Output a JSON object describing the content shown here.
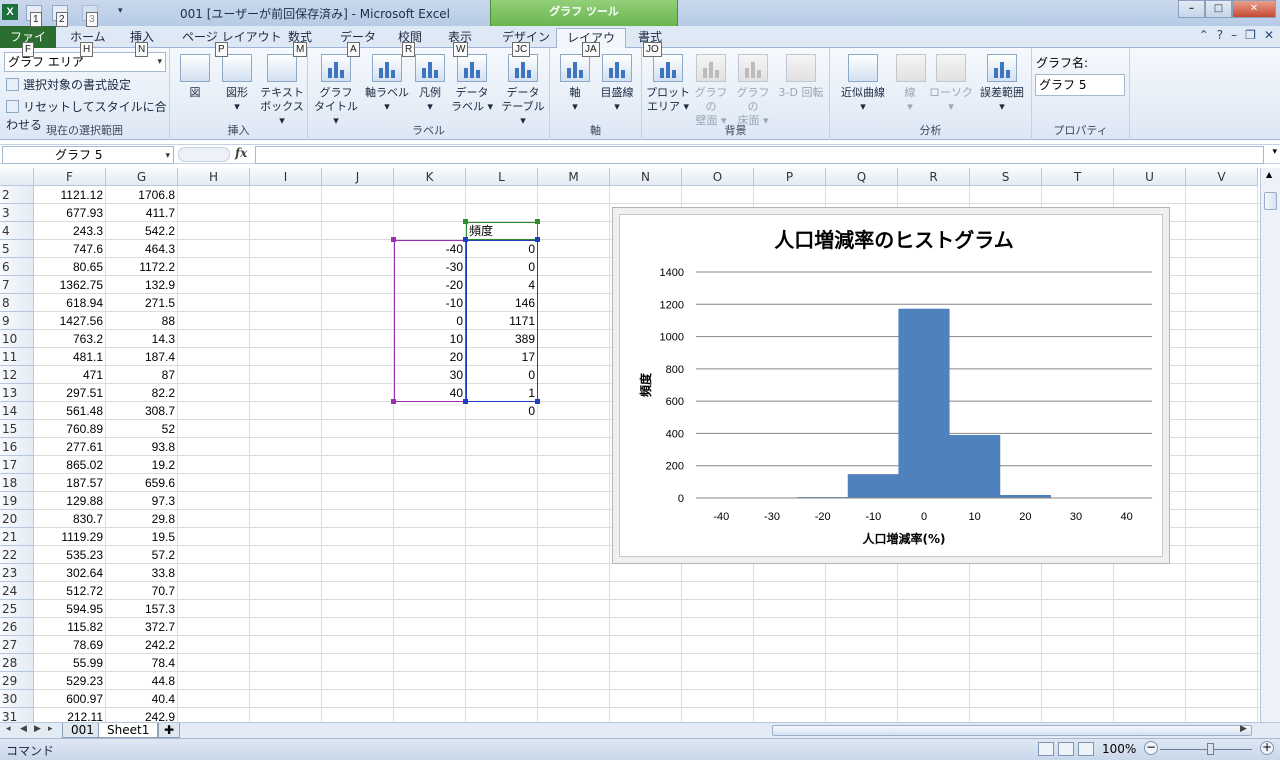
{
  "window": {
    "title": "001 [ユーザーが前回保存済み] - Microsoft Excel",
    "app_icon": "X",
    "context_tab_band": "グラフ ツール",
    "controls": {
      "minimize": "–",
      "maximize": "□",
      "close": "✕"
    }
  },
  "qat_keytips": [
    "1",
    "2",
    "3"
  ],
  "tabs": [
    {
      "label": "ファイル",
      "keytip": "F"
    },
    {
      "label": "ホーム",
      "keytip": "H"
    },
    {
      "label": "挿入",
      "keytip": "N"
    },
    {
      "label": "ページ レイアウト",
      "keytip": "P"
    },
    {
      "label": "数式",
      "keytip": "M"
    },
    {
      "label": "データ",
      "keytip": "A"
    },
    {
      "label": "校閲",
      "keytip": "R"
    },
    {
      "label": "表示",
      "keytip": "W"
    },
    {
      "label": "デザイン",
      "keytip": "JC"
    },
    {
      "label": "レイアウト",
      "keytip": "JA"
    },
    {
      "label": "書式",
      "keytip": "JO"
    }
  ],
  "ribbon": {
    "selection": {
      "dropdown_value": "グラフ エリア",
      "format_selection": "選択対象の書式設定",
      "reset_style": "リセットしてスタイルに合わせる",
      "group_label": "現在の選択範囲"
    },
    "insert": {
      "picture": "図",
      "shapes": "図形",
      "textbox_1": "テキスト",
      "textbox_2": "ボックス",
      "group_label": "挿入"
    },
    "labels": {
      "chart_title_1": "グラフ",
      "chart_title_2": "タイトル",
      "axis_titles": "軸ラベル",
      "legend": "凡例",
      "data_labels_1": "データ",
      "data_labels_2": "ラベル",
      "data_table_1": "データ",
      "data_table_2": "テーブル",
      "group_label": "ラベル"
    },
    "axes": {
      "axes": "軸",
      "gridlines": "目盛線",
      "group_label": "軸"
    },
    "background": {
      "plot_area_1": "プロット",
      "plot_area_2": "エリア",
      "chart_wall_1": "グラフの",
      "chart_wall_2": "壁面",
      "chart_floor_1": "グラフの",
      "chart_floor_2": "床面",
      "rotation_3d": "3-D 回転",
      "group_label": "背景"
    },
    "analysis": {
      "trendline": "近似曲線",
      "lines": "線",
      "up_down_bars": "ローソク",
      "error_bars": "誤差範囲",
      "group_label": "分析"
    },
    "properties": {
      "chart_name_label": "グラフ名:",
      "chart_name_value": "グラフ 5",
      "group_label": "プロパティ"
    }
  },
  "formula_bar": {
    "name_box": "グラフ 5",
    "fx": "fx",
    "formula": ""
  },
  "sheet": {
    "columns": [
      "F",
      "G",
      "H",
      "I",
      "J",
      "K",
      "L",
      "M",
      "N",
      "O",
      "P",
      "Q",
      "R",
      "S",
      "T",
      "U",
      "V"
    ],
    "rows": [
      "2",
      "3",
      "4",
      "5",
      "6",
      "7",
      "8",
      "9",
      "10",
      "11",
      "12",
      "13",
      "14",
      "15",
      "16",
      "17",
      "18",
      "19",
      "20",
      "21",
      "22",
      "23",
      "24",
      "25",
      "26",
      "27",
      "28",
      "29",
      "30",
      "31"
    ],
    "col_F": [
      "1121.12",
      "677.93",
      "243.3",
      "747.6",
      "80.65",
      "1362.75",
      "618.94",
      "1427.56",
      "763.2",
      "481.1",
      "471",
      "297.51",
      "561.48",
      "760.89",
      "277.61",
      "865.02",
      "187.57",
      "129.88",
      "830.7",
      "1119.29",
      "535.23",
      "302.64",
      "512.72",
      "594.95",
      "115.82",
      "78.69",
      "55.99",
      "529.23",
      "600.97",
      "212.11"
    ],
    "col_G": [
      "1706.8",
      "411.7",
      "542.2",
      "464.3",
      "1172.2",
      "132.9",
      "271.5",
      "88",
      "14.3",
      "187.4",
      "87",
      "82.2",
      "308.7",
      "52",
      "93.8",
      "19.2",
      "659.6",
      "97.3",
      "29.8",
      "19.5",
      "57.2",
      "33.8",
      "70.7",
      "157.3",
      "372.7",
      "242.2",
      "78.4",
      "44.8",
      "40.4",
      "242.9"
    ],
    "freq_header": "頻度",
    "col_K": [
      "-40",
      "-30",
      "-20",
      "-10",
      "0",
      "10",
      "20",
      "30",
      "40"
    ],
    "col_L": [
      "0",
      "0",
      "4",
      "146",
      "1171",
      "389",
      "17",
      "0",
      "1",
      "0"
    ]
  },
  "chart_data": {
    "type": "bar",
    "title": "人口増減率のヒストグラム",
    "xlabel": "人口増減率(%)",
    "ylabel": "頻度",
    "categories": [
      "-40",
      "-30",
      "-20",
      "-10",
      "0",
      "10",
      "20",
      "30",
      "40"
    ],
    "values": [
      0,
      0,
      4,
      146,
      1171,
      389,
      17,
      0,
      1
    ],
    "yticks": [
      "0",
      "200",
      "400",
      "600",
      "800",
      "1000",
      "1200",
      "1400"
    ],
    "ylim": [
      0,
      1400
    ],
    "grid": true,
    "bar_color": "#4f81bd",
    "gap": "none"
  },
  "sheet_tabs": [
    "001",
    "Sheet1"
  ],
  "status": {
    "mode": "コマンド",
    "zoom": "100%"
  }
}
